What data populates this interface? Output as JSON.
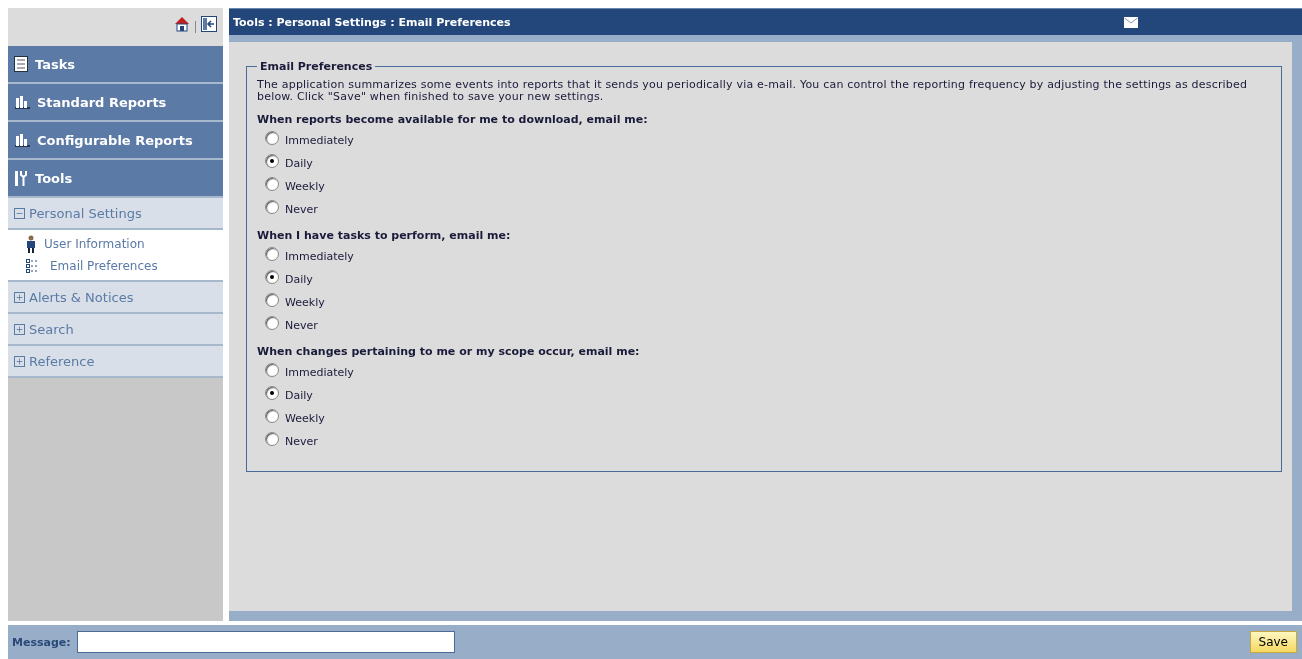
{
  "breadcrumb": "Tools : Personal Settings : Email Preferences",
  "sidebar": {
    "sections": [
      {
        "label": "Tasks",
        "kind": "tasks"
      },
      {
        "label": "Standard Reports",
        "kind": "reports"
      },
      {
        "label": "Configurable Reports",
        "kind": "reports"
      },
      {
        "label": "Tools",
        "kind": "tools"
      }
    ],
    "tree": [
      {
        "label": "Personal Settings",
        "expanded": true,
        "children": [
          {
            "label": "User Information",
            "kind": "user"
          },
          {
            "label": "Email Preferences",
            "kind": "list"
          }
        ]
      },
      {
        "label": "Alerts & Notices",
        "expanded": false
      },
      {
        "label": "Search",
        "expanded": false
      },
      {
        "label": "Reference",
        "expanded": false
      }
    ]
  },
  "panel": {
    "legend": "Email Preferences",
    "intro": "The application summarizes some events into reports that it sends you periodically via e-mail. You can control the reporting frequency by adjusting the settings as described below. Click \"Save\" when finished to save your new settings.",
    "groups": [
      {
        "question": "When reports become available for me to download, email me:",
        "options": [
          {
            "label": "Immediately",
            "selected": false
          },
          {
            "label": "Daily",
            "selected": true
          },
          {
            "label": "Weekly",
            "selected": false
          },
          {
            "label": "Never",
            "selected": false
          }
        ]
      },
      {
        "question": "When I have tasks to perform, email me:",
        "options": [
          {
            "label": "Immediately",
            "selected": false
          },
          {
            "label": "Daily",
            "selected": true
          },
          {
            "label": "Weekly",
            "selected": false
          },
          {
            "label": "Never",
            "selected": false
          }
        ]
      },
      {
        "question": "When changes pertaining to me or my scope occur, email me:",
        "options": [
          {
            "label": "Immediately",
            "selected": false
          },
          {
            "label": "Daily",
            "selected": true
          },
          {
            "label": "Weekly",
            "selected": false
          },
          {
            "label": "Never",
            "selected": false
          }
        ]
      }
    ]
  },
  "footer": {
    "label": "Message:",
    "save": "Save"
  }
}
